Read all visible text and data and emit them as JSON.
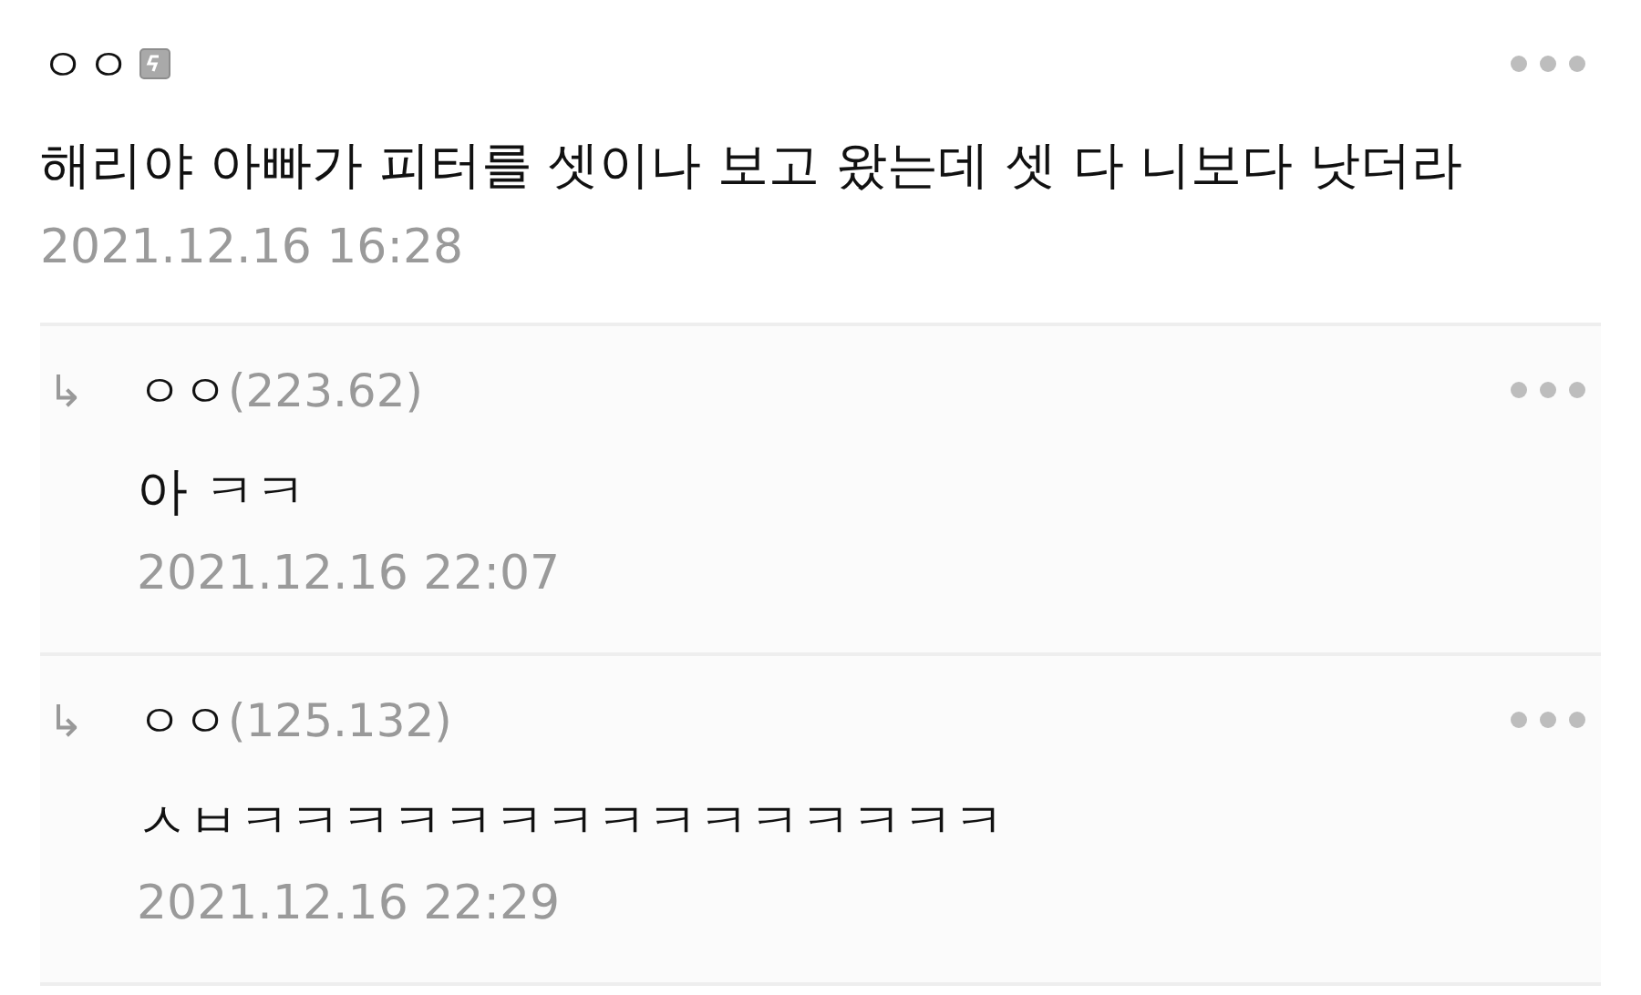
{
  "comments": [
    {
      "kind": "comment",
      "author": "ㅇㅇ",
      "text": "해리야 아빠가 피터를 셋이나 보고 왔는데 셋 다 니보다 낫더라",
      "date": "2021.12.16 16:28"
    },
    {
      "kind": "reply",
      "reply_mark": "↳",
      "author": "ㅇㅇ",
      "ip": "(223.62)",
      "text": "아 ㅋㅋ",
      "date": "2021.12.16 22:07"
    },
    {
      "kind": "reply",
      "reply_mark": "↳",
      "author": "ㅇㅇ",
      "ip": "(125.132)",
      "text": "ㅅㅂㅋㅋㅋㅋㅋㅋㅋㅋㅋㅋㅋㅋㅋㅋㅋ",
      "date": "2021.12.16 22:29"
    }
  ]
}
